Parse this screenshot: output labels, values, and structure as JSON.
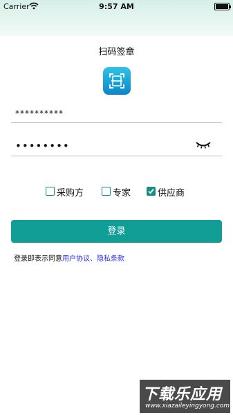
{
  "status_bar": {
    "carrier": "Carrier",
    "time": "9:57 AM"
  },
  "header": {
    "title": "扫码签章",
    "logo_icon": "scan-document-icon",
    "logo_color": "#1aa6dc"
  },
  "form": {
    "username_value": "**********",
    "password_value": "••••••••",
    "password_toggle_icon": "eye-closed-icon"
  },
  "roles": [
    {
      "label": "采购方",
      "checked": false
    },
    {
      "label": "专家",
      "checked": false
    },
    {
      "label": "供应商",
      "checked": true
    }
  ],
  "login_button": {
    "label": "登录",
    "color": "#109e96"
  },
  "agreement": {
    "prefix": "登录即表示同意",
    "link_text": "用户协议、隐私条款"
  },
  "watermark": {
    "main": "下载乐应用",
    "sub": "www.xiazaileyingyong.com"
  }
}
